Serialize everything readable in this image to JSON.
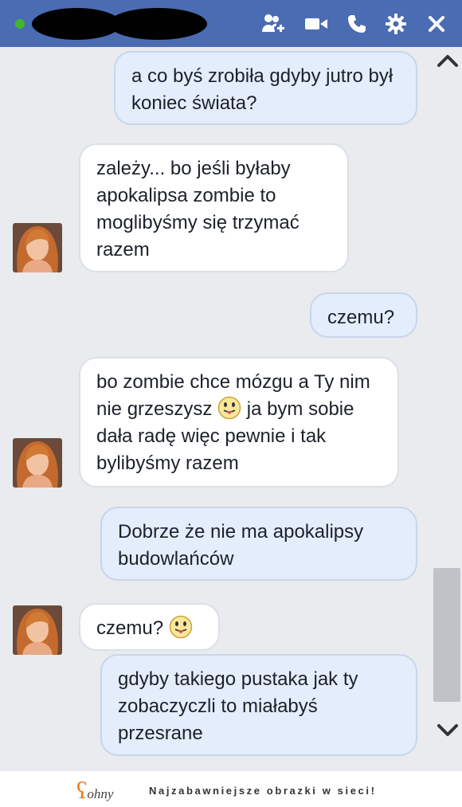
{
  "messages": [
    {
      "side": "out",
      "text": "a co byś zrobiła gdyby jutro był koniec świata?"
    },
    {
      "side": "in",
      "text": "zależy... bo jeśli byłaby apokalipsa zombie to moglibyśmy się trzymać razem"
    },
    {
      "side": "out",
      "text": "czemu?"
    },
    {
      "side": "in",
      "text_before": "bo zombie chce mózgu a Ty nim nie grzeszysz",
      "text_after": "ja bym sobie dała radę więc pewnie i tak bylibyśmy razem"
    },
    {
      "side": "out",
      "text": "Dobrze że nie ma apokalipsy budowlańców"
    },
    {
      "side": "in",
      "text": "czemu?"
    },
    {
      "side": "out",
      "text": "gdyby takiego pustaka  jak ty zobaczyczli to miałabyś przesrane"
    }
  ],
  "footer": {
    "logo_text": "ohny",
    "tagline": "Najzabawniejsze obrazki w sieci!"
  },
  "colors": {
    "header": "#4a6cb3",
    "chat_bg": "#e9ebee",
    "outgoing": "#e3edfb",
    "incoming": "#ffffff",
    "online": "#42b72a"
  }
}
